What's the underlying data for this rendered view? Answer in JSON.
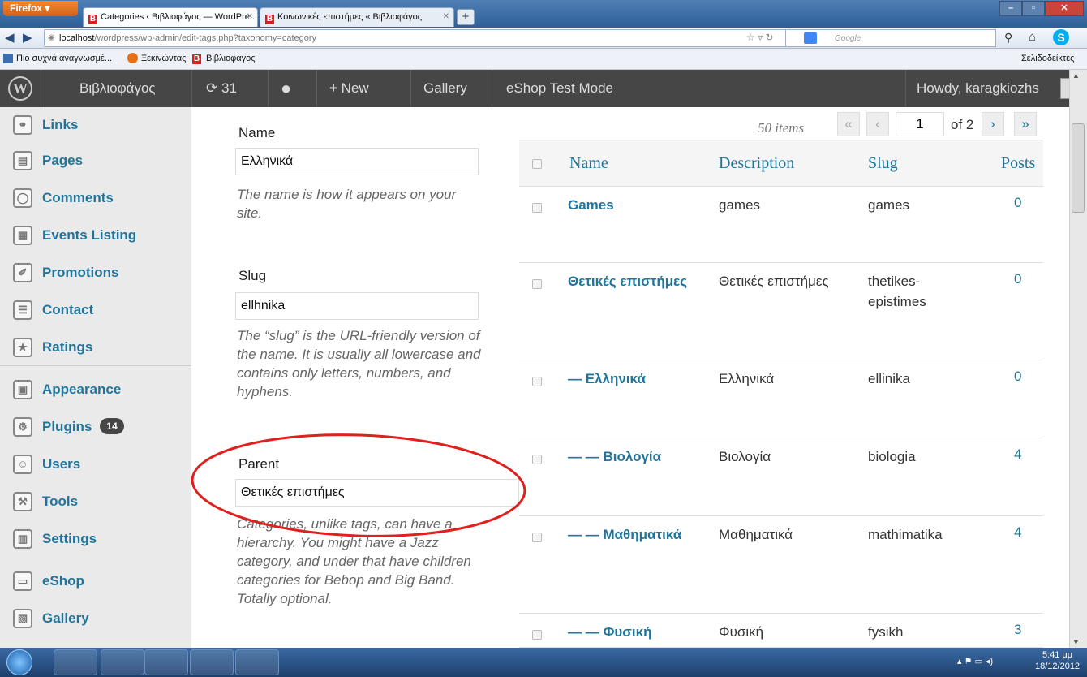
{
  "browser": {
    "menu_button": "Firefox",
    "tabs": [
      {
        "title": "Categories ‹ Βιβλιοφάγος — WordPre...",
        "active": true
      },
      {
        "title": "Κοινωνικές επιστήμες « Βιβλιοφάγος",
        "active": false
      }
    ],
    "new_tab": "+",
    "url_host": "localhost",
    "url_path": "/wordpress/wp-admin/edit-tags.php?taxonomy=category",
    "search_placeholder": "Google",
    "bookmarks": [
      "Πιο συχνά αναγνωσμέ...",
      "Ξεκινώντας",
      "Βιβλιοφαγος"
    ],
    "bookmarks_right": "Σελιδοδείκτες"
  },
  "adminbar": {
    "site_name": "Βιβλιοφάγος",
    "updates_count": "31",
    "new_label": "New",
    "gallery_label": "Gallery",
    "eshop_label": "eShop Test Mode",
    "howdy": "Howdy, karagkiozhs"
  },
  "sidebar": {
    "items": [
      {
        "label": "Links",
        "icon": "link-icon"
      },
      {
        "label": "Pages",
        "icon": "pages-icon"
      },
      {
        "label": "Comments",
        "icon": "comments-icon"
      },
      {
        "label": "Events Listing",
        "icon": "calendar-icon"
      },
      {
        "label": "Promotions",
        "icon": "pin-icon"
      },
      {
        "label": "Contact",
        "icon": "contact-icon"
      },
      {
        "label": "Ratings",
        "icon": "star-icon"
      },
      {
        "label": "Appearance",
        "icon": "appearance-icon"
      },
      {
        "label": "Plugins",
        "icon": "plugin-icon",
        "badge": "14"
      },
      {
        "label": "Users",
        "icon": "users-icon"
      },
      {
        "label": "Tools",
        "icon": "tools-icon"
      },
      {
        "label": "Settings",
        "icon": "settings-icon"
      },
      {
        "label": "eShop",
        "icon": "eshop-icon"
      },
      {
        "label": "Gallery",
        "icon": "gallery-icon"
      }
    ]
  },
  "form": {
    "name_label": "Name",
    "name_value": "Ελληνικά",
    "name_desc": "The name is how it appears on your site.",
    "slug_label": "Slug",
    "slug_value": "ellhnika",
    "slug_desc": "The “slug” is the URL-friendly version of the name. It is usually all lowercase and contains only letters, numbers, and hyphens.",
    "parent_label": "Parent",
    "parent_value": "Θετικές επιστήμες",
    "parent_desc": "Categories, unlike tags, can have a hierarchy. You might have a Jazz category, and under that have children categories for Bebop and Big Band. Totally optional."
  },
  "table": {
    "items_count": "50 items",
    "first": "«",
    "prev": "‹",
    "current_page": "1",
    "of_pages": "of 2",
    "next": "›",
    "last": "»",
    "headers": {
      "name": "Name",
      "description": "Description",
      "slug": "Slug",
      "posts": "Posts"
    },
    "rows": [
      {
        "name": "Games",
        "description": "games",
        "slug": "games",
        "posts": "0"
      },
      {
        "name": "Θετικές επιστήμες",
        "description": "Θετικές επιστήμες",
        "slug": "thetikes-epistimes",
        "posts": "0"
      },
      {
        "name": "— Ελληνικά",
        "description": "Ελληνικά",
        "slug": "ellinika",
        "posts": "0"
      },
      {
        "name": "— — Βιολογία",
        "description": "Βιολογία",
        "slug": "biologia",
        "posts": "4"
      },
      {
        "name": "— — Μαθηματικά",
        "description": "Μαθηματικά",
        "slug": "mathimatika",
        "posts": "4"
      },
      {
        "name": "— — Φυσική",
        "description": "Φυσική",
        "slug": "fysikh",
        "posts": "3"
      }
    ]
  },
  "taskbar": {
    "time": "5:41 μμ",
    "date": "18/12/2012"
  },
  "colors": {
    "link": "#21759b",
    "adminbar": "#464646",
    "annotation": "#e0201c"
  }
}
